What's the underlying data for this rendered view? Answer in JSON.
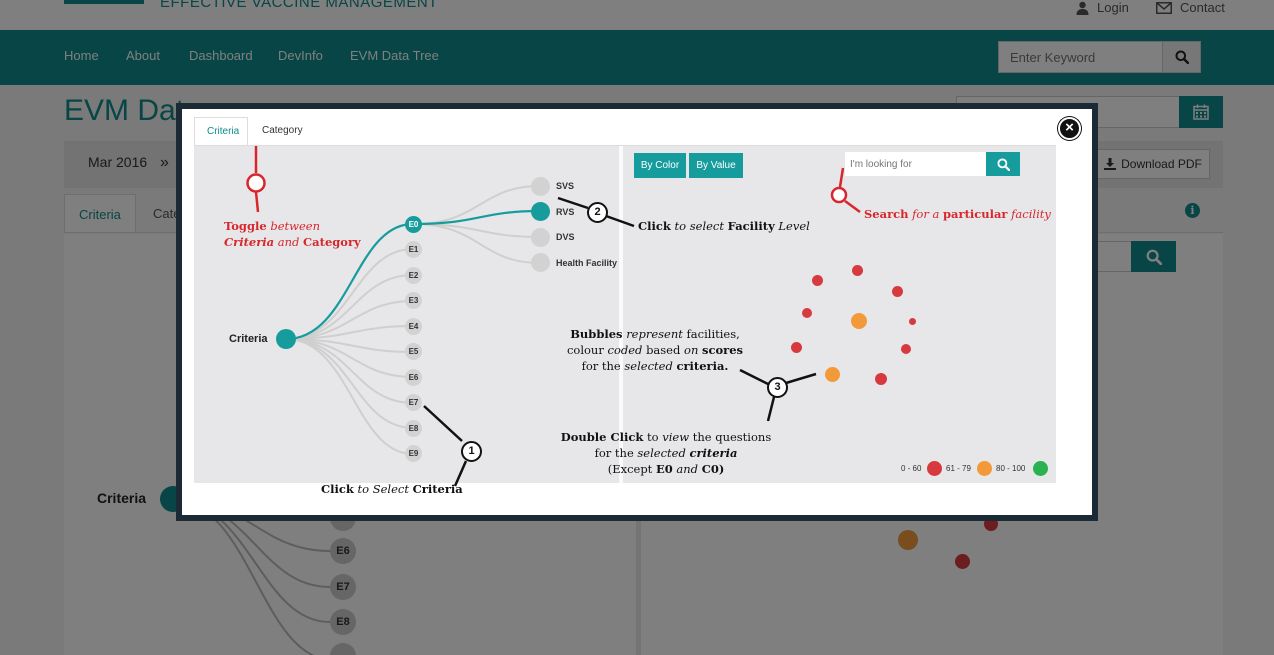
{
  "header": {
    "brand": "EFFECTIVE VACCINE MANAGEMENT",
    "login": "Login",
    "contact": "Contact"
  },
  "nav": {
    "items": [
      "Home",
      "About",
      "Dashboard",
      "DevInfo",
      "EVM Data Tree"
    ],
    "search_placeholder": "Enter Keyword"
  },
  "page": {
    "title": "EVM Dat",
    "period": "Mar 2016",
    "period_arrow": "»",
    "download_label": "Download PDF",
    "tabs": [
      "Criteria",
      "Cate"
    ],
    "tree_root": "Criteria",
    "visible_nodes": [
      "E6",
      "E7",
      "E8"
    ]
  },
  "modal": {
    "tabs": [
      "Criteria",
      "Category"
    ],
    "buttons": {
      "by_color": "By Color",
      "by_value": "By Value"
    },
    "search_placeholder": "I'm looking for",
    "root_label": "Criteria",
    "criteria_nodes": [
      "E0",
      "E1",
      "E2",
      "E3",
      "E4",
      "E5",
      "E6",
      "E7",
      "E8",
      "E9"
    ],
    "selected_criteria": "E0",
    "levels": [
      "SVS",
      "RVS",
      "DVS",
      "Health Facility"
    ],
    "selected_level": "RVS",
    "steps": {
      "step1": "1",
      "step2": "2",
      "step3": "3"
    },
    "annotations": {
      "toggle": {
        "w1": "Toggle",
        "w2": "between",
        "w3": "Criteria",
        "w4": "and",
        "w5": "Category"
      },
      "select_level": {
        "w1": "Click",
        "w2": "to select",
        "w3": "Facility",
        "w4": "Level"
      },
      "search": {
        "w1": "Search",
        "w2": "for a",
        "w3": "particular",
        "w4": "facility"
      },
      "bubbles": {
        "l1a": "Bubbles",
        "l1b": "represent",
        "l1c": "facilities,",
        "l2a": "colour",
        "l2b": "coded",
        "l2c": "based",
        "l2d": "on",
        "l2e": "scores",
        "l3a": "for the",
        "l3b": "selected",
        "l3c": "criteria."
      },
      "double_click": {
        "l1a": "Double Click",
        "l1b": "to",
        "l1c": "view",
        "l1d": "the questions",
        "l2a": "for the",
        "l2b": "selected",
        "l2c": "criteria",
        "l3a": "(Except",
        "l3b": "E0",
        "l3c": "and",
        "l3d": "C0)"
      },
      "select_criteria": {
        "w1": "Click",
        "w2": "to Select",
        "w3": "Criteria"
      }
    },
    "legend": [
      {
        "label": "0 - 60",
        "color": "#d63a3f"
      },
      {
        "label": "61 - 79",
        "color": "#f29a3a"
      },
      {
        "label": "80 - 100",
        "color": "#2ab250"
      }
    ]
  },
  "colors": {
    "teal": "#0f8a8c",
    "accent": "#179c9d",
    "low": "#d63a3f",
    "mid": "#f29a3a",
    "high": "#2ab250",
    "annotation_red": "#d8262c"
  }
}
